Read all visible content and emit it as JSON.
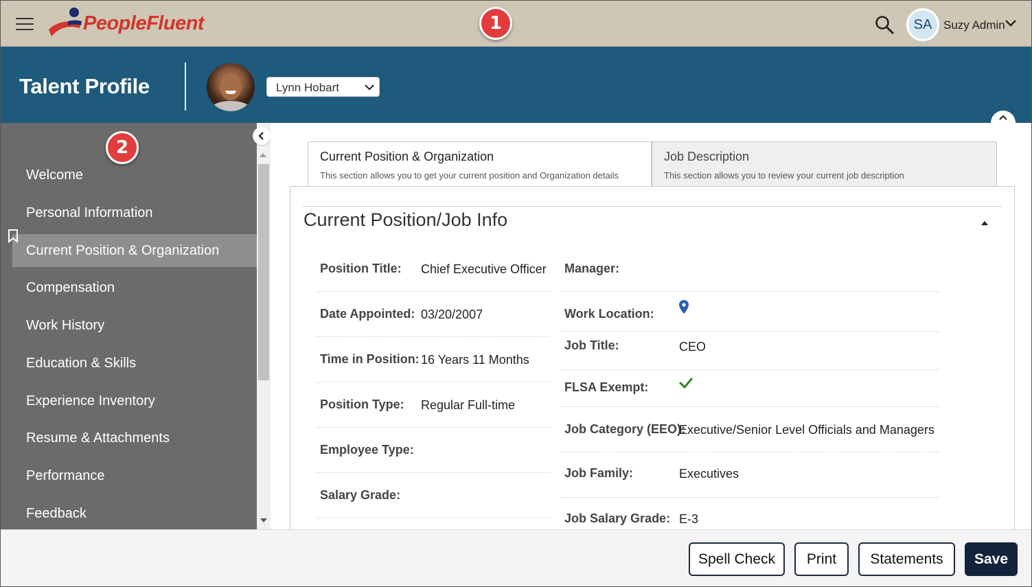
{
  "topbar": {
    "logo_text": "PeopleFluent",
    "user_initials": "SA",
    "user_name": "Suzy Admin",
    "step1": "1"
  },
  "header": {
    "title": "Talent Profile",
    "person": "Lynn Hobart"
  },
  "sidebar": {
    "step2": "2",
    "items": [
      {
        "label": "Welcome"
      },
      {
        "label": "Personal Information"
      },
      {
        "label": "Current Position & Organization"
      },
      {
        "label": "Compensation"
      },
      {
        "label": "Work History"
      },
      {
        "label": "Education & Skills"
      },
      {
        "label": "Experience Inventory"
      },
      {
        "label": "Resume & Attachments"
      },
      {
        "label": "Performance"
      },
      {
        "label": "Feedback"
      }
    ]
  },
  "tabs": [
    {
      "title": "Current Position & Organization",
      "subtitle": "This section allows you to get your current position and Organization details"
    },
    {
      "title": "Job Description",
      "subtitle": "This section allows you to review your current job description"
    }
  ],
  "section": {
    "title": "Current Position/Job Info",
    "left": [
      {
        "label": "Position Title:",
        "value": "Chief Executive Officer"
      },
      {
        "label": "Date Appointed:",
        "value": "03/20/2007"
      },
      {
        "label": "Time in Position:",
        "value": "16 Years 11 Months"
      },
      {
        "label": "Position Type:",
        "value": "Regular Full-time"
      },
      {
        "label": "Employee Type:",
        "value": ""
      },
      {
        "label": "Salary Grade:",
        "value": ""
      }
    ],
    "right": [
      {
        "label": "Manager:",
        "value": ""
      },
      {
        "label": "Work Location:",
        "value": ""
      },
      {
        "label": "Job Title:",
        "value": "CEO"
      },
      {
        "label": "FLSA Exempt:",
        "value": ""
      },
      {
        "label": "Job Category (EEO):",
        "value": "Executive/Senior Level Officials and Managers"
      },
      {
        "label": "Job Family:",
        "value": "Executives"
      },
      {
        "label": "Job Salary Grade:",
        "value": "E-3"
      }
    ]
  },
  "footer": {
    "spell_check": "Spell Check",
    "print": "Print",
    "statements": "Statements",
    "save": "Save"
  },
  "colors": {
    "topbar": "#cfc7b5",
    "header": "#1e5a7c",
    "sidebar": "#6b6b6b",
    "sidebar_active": "#8e8e8e",
    "badge": "#e23c3c",
    "save_button": "#13233a",
    "check": "#3a8a2c",
    "location_pin": "#2a5fae"
  }
}
